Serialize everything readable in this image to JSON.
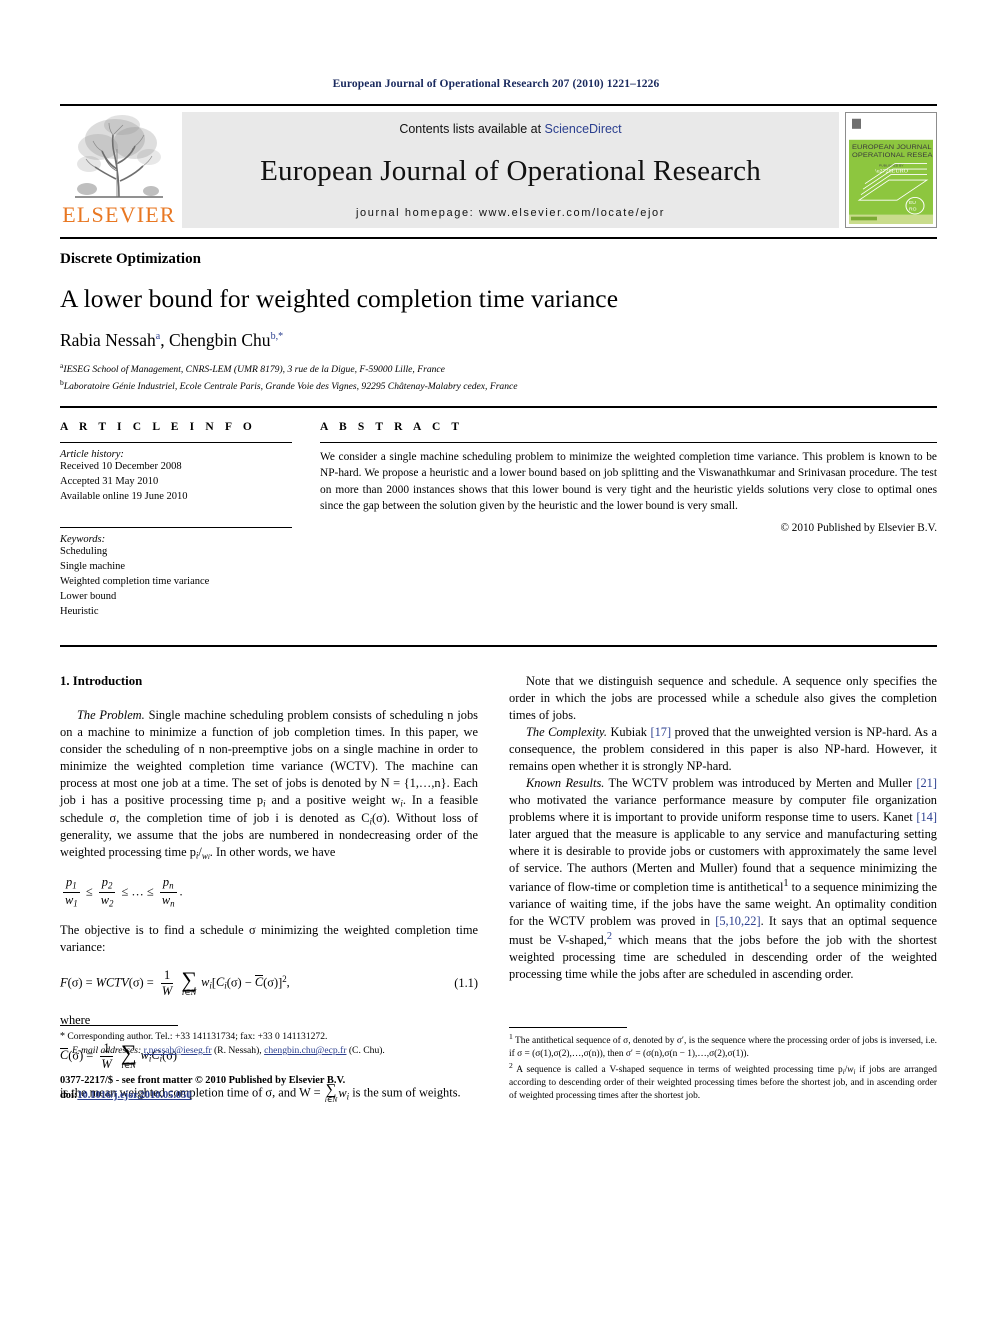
{
  "running_head": "European Journal of Operational Research 207 (2010) 1221–1226",
  "masthead": {
    "publisher_name": "ELSEVIER",
    "contents_prefix": "Contents lists available at ",
    "contents_link": "ScienceDirect",
    "journal_name": "European Journal of Operational Research",
    "homepage": "journal homepage: www.elsevier.com/locate/ejor",
    "cover_title_line1": "EUROPEAN JOURNAL OF",
    "cover_title_line2": "OPERATIONAL RESEARCH",
    "cover_mark": "EURO"
  },
  "article": {
    "section": "Discrete Optimization",
    "title": "A lower bound for weighted completion time variance",
    "authors": "Rabia Nessah , Chengbin Chu",
    "author1": "Rabia Nessah",
    "author1_sup": "a",
    "author2": "Chengbin Chu",
    "author2_sup": "b,*",
    "affiliation_a_sup": "a",
    "affiliation_a": "IESEG School of Management, CNRS-LEM (UMR 8179), 3 rue de la Digue, F-59000 Lille, France",
    "affiliation_b_sup": "b",
    "affiliation_b": "Laboratoire Génie Industriel, Ecole Centrale Paris, Grande Voie des Vignes, 92295 Châtenay-Malabry cedex, France"
  },
  "info": {
    "heading": "A R T I C L E    I N F O",
    "history_label": "Article history:",
    "history": [
      "Received 10 December 2008",
      "Accepted 31 May 2010",
      "Available online 19 June 2010"
    ],
    "keywords_label": "Keywords:",
    "keywords": [
      "Scheduling",
      "Single machine",
      "Weighted completion time variance",
      "Lower bound",
      "Heuristic"
    ]
  },
  "abstract": {
    "heading": "A B S T R A C T",
    "text": "We consider a single machine scheduling problem to minimize the weighted completion time variance. This problem is known to be NP-hard. We propose a heuristic and a lower bound based on job splitting and the Viswanathkumar and Srinivasan procedure. The test on more than 2000 instances shows that this lower bound is very tight and the heuristic yields solutions very close to optimal ones since the gap between the solution given by the heuristic and the lower bound is very small.",
    "copyright": "© 2010 Published by Elsevier B.V."
  },
  "body": {
    "section1_heading": "1. Introduction",
    "p1_runin": "The Problem.",
    "p1": " Single machine scheduling problem consists of scheduling n jobs on a machine to minimize a function of job completion times. In this paper, we consider the scheduling of n non-preemptive jobs on a single machine in order to minimize the weighted completion time variance (WCTV). The machine can process at most one job at a time. The set of jobs is denoted by N = {1,…,n}. Each job i has a positive processing time p",
    "p1_cont": " and a positive weight w",
    "p1_cont2": ". In a feasible schedule σ, the completion time of job i is denoted as C",
    "p1_cont3": "(σ). Without loss of generality, we assume that the jobs are numbered in nondecreasing order of the weighted processing time p",
    "p1_cont4": ". In other words, we have",
    "p2": "The objective is to find a schedule σ minimizing the weighted completion time variance:",
    "eq_number": "(1.1)",
    "p3": "where",
    "p4_a": "is the mean weighted completion time of σ, and W = ",
    "p4_b": " is the sum of weights.",
    "r_p1": "Note that we distinguish sequence and schedule. A sequence only specifies the order in which the jobs are processed while a schedule also gives the completion times of jobs.",
    "r_p2_runin": "The Complexity.",
    "r_p2_a": " Kubiak ",
    "r_p2_cite1": "[17]",
    "r_p2_b": " proved that the unweighted version is NP-hard. As a consequence, the problem considered in this paper is also NP-hard. However, it remains open whether it is strongly NP-hard.",
    "r_p3_runin": "Known Results.",
    "r_p3_a": " The WCTV problem was introduced by Merten and Muller ",
    "r_p3_cite1": "[21]",
    "r_p3_b": " who motivated the variance performance measure by computer file organization problems where it is important to provide uniform response time to users. Kanet ",
    "r_p3_cite2": "[14]",
    "r_p3_c": " later argued that the measure is applicable to any service and manufacturing setting where it is desirable to provide jobs or customers with approximately the same level of service. The authors (Merten and Muller) found that a sequence minimizing the variance of flow-time or completion time is antithetical",
    "r_p3_fn1": "1",
    "r_p3_d": " to a sequence minimizing the variance of waiting time, if the jobs have the same weight. An optimality condition for the WCTV problem was proved in ",
    "r_p3_cite3": "[5,10,22]",
    "r_p3_e": ". It says that an optimal sequence must be V-shaped,",
    "r_p3_fn2": "2",
    "r_p3_f": " which means that the jobs before the job with the shortest weighted processing time are scheduled in descending order of the weighted processing time while the jobs after are scheduled in ascending order."
  },
  "footnotes": {
    "fn1_marker": "1",
    "fn1_a": " The antithetical sequence of σ, denoted by σ′, is the sequence where the processing order of jobs is inversed, i.e. if σ = (σ(1),σ(2),…,σ(n)), then σ′ = (σ(n),σ(n − 1),…,σ(2),σ(1)).",
    "fn2_marker": "2",
    "fn2_a": " A sequence is called a V-shaped sequence in terms of weighted processing time p",
    "fn2_b": " if jobs are arranged according to descending order of their weighted processing times before the shortest job, and in ascending order of weighted processing times after the shortest job."
  },
  "correspondence": {
    "star": "*",
    "line1": " Corresponding author. Tel.: +33 141131734; fax: +33 0 141131272.",
    "email_label": "E-mail addresses:",
    "email1": "r.nessah@ieseg.fr",
    "email1_who": " (R. Nessah),",
    "email2": "chengbin.chu@ecp.fr",
    "email2_who": " (C. Chu).",
    "issn_line": "0377-2217/$ - see front matter © 2010 Published by Elsevier B.V.",
    "doi_label": "doi:",
    "doi": "10.1016/j.ejor.2010.05.050"
  },
  "colors": {
    "runhead": "#1a2a5e",
    "link": "#2b3f8f",
    "elsevier_orange": "#e87722",
    "band_gray": "#e9e9e9",
    "cover_green": "#8dc63f"
  }
}
